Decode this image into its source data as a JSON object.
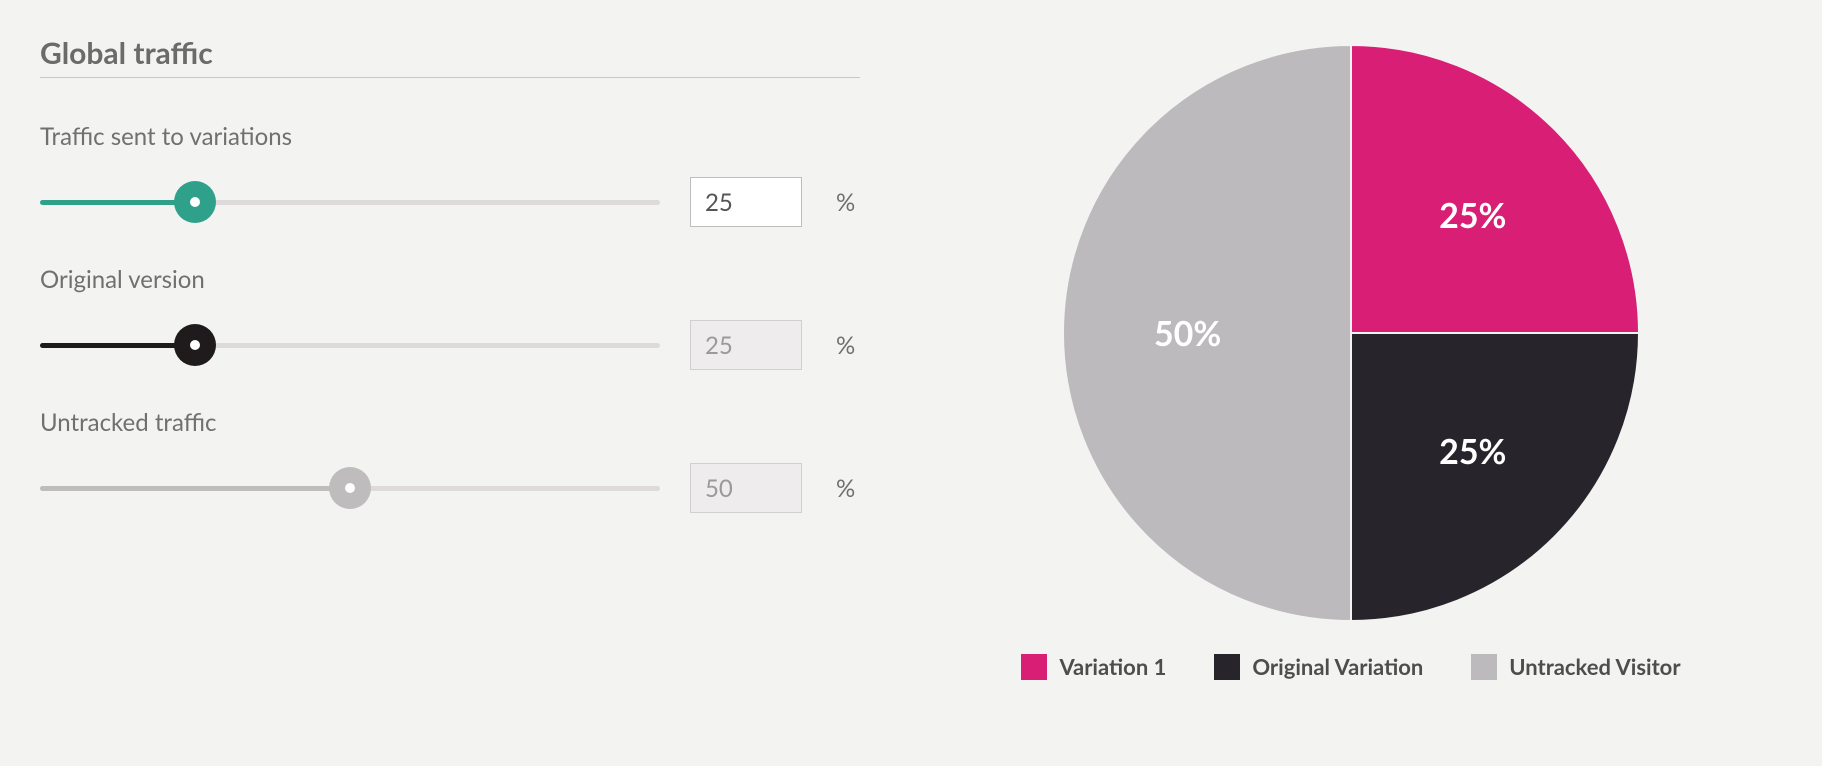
{
  "title": "Global traffic",
  "sliders": {
    "variations": {
      "label": "Traffic sent to variations",
      "value": "25",
      "unit": "%",
      "percent": 25,
      "editable": true
    },
    "original": {
      "label": "Original version",
      "value": "25",
      "unit": "%",
      "percent": 25,
      "editable": false
    },
    "untracked": {
      "label": "Untracked traffic",
      "value": "50",
      "unit": "%",
      "percent": 50,
      "editable": false
    }
  },
  "colors": {
    "variation1": "#d91e76",
    "original": "#27242b",
    "untracked": "#bcbabc",
    "slider_accent": "#2fa18a"
  },
  "legend": [
    {
      "label": "Variation 1",
      "color_key": "variation1"
    },
    {
      "label": "Original Variation",
      "color_key": "original"
    },
    {
      "label": "Untracked Visitor",
      "color_key": "untracked"
    }
  ],
  "chart_data": {
    "type": "pie",
    "series": [
      {
        "name": "Variation 1",
        "value": 25,
        "label": "25%",
        "color_key": "variation1"
      },
      {
        "name": "Original Variation",
        "value": 25,
        "label": "25%",
        "color_key": "original"
      },
      {
        "name": "Untracked Visitor",
        "value": 50,
        "label": "50%",
        "color_key": "untracked"
      }
    ]
  }
}
